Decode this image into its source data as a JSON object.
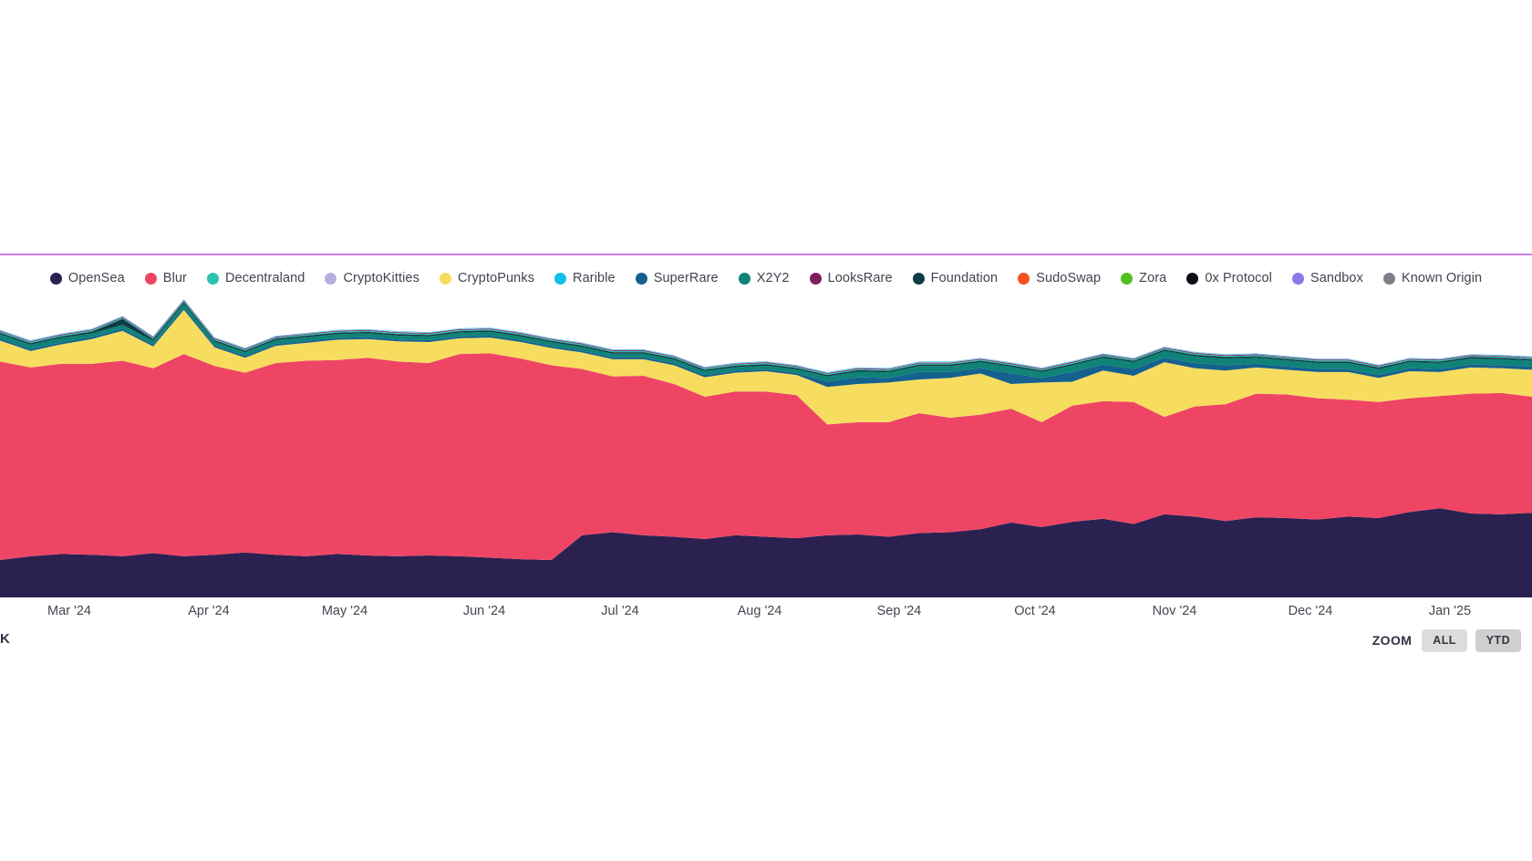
{
  "theme": {
    "divider_color": "#c77fe8",
    "background": "#ffffff",
    "text_color": "#43474f",
    "button_bg": "#dcdcdc"
  },
  "legend": {
    "items": [
      {
        "label": "OpenSea",
        "color": "#2b2151"
      },
      {
        "label": "Blur",
        "color": "#ef4565"
      },
      {
        "label": "Decentraland",
        "color": "#2cc3b0"
      },
      {
        "label": "CryptoKitties",
        "color": "#b6b0e0"
      },
      {
        "label": "CryptoPunks",
        "color": "#f6dd5f"
      },
      {
        "label": "Rarible",
        "color": "#12bfeb"
      },
      {
        "label": "SuperRare",
        "color": "#14618f"
      },
      {
        "label": "X2Y2",
        "color": "#0f8377"
      },
      {
        "label": "LooksRare",
        "color": "#7b1f5a"
      },
      {
        "label": "Foundation",
        "color": "#113b44"
      },
      {
        "label": "SudoSwap",
        "color": "#f4511e"
      },
      {
        "label": "Zora",
        "color": "#4fc020"
      },
      {
        "label": "0x Protocol",
        "color": "#0d0d17"
      },
      {
        "label": "Sandbox",
        "color": "#8878e8"
      },
      {
        "label": "Known Origin",
        "color": "#7c8088"
      }
    ]
  },
  "footer": {
    "y_axis_unit": "K",
    "zoom_label": "ZOOM",
    "zoom_buttons": [
      {
        "label": "ALL",
        "active": false
      },
      {
        "label": "YTD",
        "active": true
      }
    ]
  },
  "chart_data": {
    "type": "area",
    "stacked": true,
    "stack_mode": "absolute",
    "title": "",
    "xlabel": "",
    "ylabel": "K",
    "grid": false,
    "legend_position": "top-center",
    "axis_tick_labels": [
      "Mar '24",
      "Apr '24",
      "May '24",
      "Jun '24",
      "Jul '24",
      "Aug '24",
      "Sep '24",
      "Oct '24",
      "Nov '24",
      "Dec '24",
      "Jan '25"
    ],
    "x": [
      "2024-02-18",
      "2024-02-25",
      "2024-03-03",
      "2024-03-10",
      "2024-03-17",
      "2024-03-24",
      "2024-03-31",
      "2024-04-07",
      "2024-04-14",
      "2024-04-21",
      "2024-04-28",
      "2024-05-05",
      "2024-05-12",
      "2024-05-19",
      "2024-05-26",
      "2024-06-02",
      "2024-06-09",
      "2024-06-16",
      "2024-06-23",
      "2024-06-30",
      "2024-07-07",
      "2024-07-14",
      "2024-07-21",
      "2024-07-28",
      "2024-08-04",
      "2024-08-11",
      "2024-08-18",
      "2024-08-25",
      "2024-09-01",
      "2024-09-08",
      "2024-09-15",
      "2024-09-22",
      "2024-09-29",
      "2024-10-06",
      "2024-10-13",
      "2024-10-20",
      "2024-10-27",
      "2024-11-03",
      "2024-11-10",
      "2024-11-17",
      "2024-11-24",
      "2024-12-01",
      "2024-12-08",
      "2024-12-15",
      "2024-12-22",
      "2024-12-29",
      "2025-01-05",
      "2025-01-12",
      "2025-01-19",
      "2025-01-26",
      "2025-02-02"
    ],
    "series": [
      {
        "name": "OpenSea",
        "color": "#2b2151",
        "values": [
          10.0,
          11.0,
          11.6,
          11.4,
          11.0,
          11.8,
          11.0,
          11.4,
          12.0,
          11.4,
          11.0,
          11.6,
          11.2,
          11.0,
          11.2,
          11.0,
          10.6,
          10.2,
          10.0,
          16.6,
          17.4,
          16.6,
          16.2,
          15.6,
          16.6,
          16.2,
          15.8,
          16.6,
          16.8,
          16.2,
          17.2,
          17.4,
          18.2,
          20.0,
          18.8,
          20.2,
          21.0,
          19.6,
          22.2,
          21.6,
          20.4,
          21.4,
          21.2,
          20.8,
          21.6,
          21.2,
          22.8,
          23.8,
          22.4,
          22.2,
          22.6
        ]
      },
      {
        "name": "Blur",
        "color": "#ef4565",
        "values": [
          53.0,
          50.4,
          50.8,
          51.0,
          52.2,
          49.4,
          54.0,
          50.4,
          48.0,
          51.2,
          52.2,
          51.8,
          52.8,
          52.0,
          51.4,
          54.0,
          54.6,
          53.6,
          52.0,
          44.4,
          41.6,
          42.6,
          40.8,
          38.0,
          38.4,
          38.8,
          38.2,
          29.6,
          30.0,
          30.6,
          32.0,
          30.6,
          30.6,
          30.4,
          28.0,
          31.0,
          31.4,
          32.6,
          26.0,
          29.4,
          31.2,
          33.0,
          33.0,
          32.4,
          31.2,
          31.0,
          30.4,
          30.0,
          32.0,
          32.4,
          31.0
        ]
      },
      {
        "name": "CryptoPunks",
        "color": "#f6dd5f",
        "values": [
          5.6,
          4.4,
          5.2,
          6.6,
          8.0,
          5.8,
          11.8,
          5.0,
          4.0,
          4.6,
          4.8,
          5.4,
          5.0,
          5.4,
          5.6,
          4.2,
          4.2,
          4.4,
          4.6,
          4.4,
          4.6,
          4.4,
          5.0,
          5.2,
          5.0,
          5.4,
          5.4,
          10.0,
          10.2,
          10.6,
          9.0,
          10.6,
          11.0,
          6.6,
          10.6,
          6.4,
          8.2,
          7.0,
          14.6,
          10.2,
          9.0,
          7.0,
          6.6,
          7.0,
          7.4,
          6.4,
          7.2,
          6.4,
          7.0,
          6.6,
          7.2
        ]
      },
      {
        "name": "SuperRare",
        "color": "#14618f",
        "values": [
          0.5,
          0.5,
          0.5,
          0.5,
          0.6,
          0.5,
          0.6,
          0.5,
          0.5,
          0.5,
          0.5,
          0.5,
          0.5,
          0.5,
          0.5,
          0.5,
          0.5,
          0.5,
          0.5,
          0.5,
          0.5,
          0.5,
          0.5,
          0.6,
          0.5,
          0.5,
          0.5,
          1.4,
          1.8,
          1.2,
          2.0,
          1.6,
          1.4,
          2.8,
          1.2,
          2.6,
          1.6,
          1.8,
          1.2,
          1.4,
          1.4,
          1.0,
          0.9,
          0.8,
          0.8,
          0.8,
          0.8,
          0.8,
          0.8,
          0.8,
          0.8
        ]
      },
      {
        "name": "X2Y2",
        "color": "#0f8377",
        "values": [
          1.2,
          1.2,
          1.2,
          1.0,
          1.0,
          1.0,
          1.0,
          1.0,
          1.0,
          1.0,
          1.0,
          1.0,
          1.0,
          1.0,
          1.0,
          1.0,
          1.0,
          1.0,
          1.0,
          1.0,
          1.0,
          1.0,
          1.0,
          1.0,
          1.0,
          1.0,
          1.0,
          1.4,
          1.5,
          1.5,
          1.6,
          1.6,
          1.6,
          1.8,
          1.6,
          1.8,
          1.8,
          1.8,
          1.8,
          1.8,
          1.8,
          1.6,
          1.6,
          1.6,
          1.6,
          1.6,
          1.6,
          1.6,
          1.6,
          1.6,
          1.6
        ]
      },
      {
        "name": "Foundation",
        "color": "#113b44",
        "values": [
          0.4,
          0.4,
          0.4,
          0.5,
          1.6,
          0.5,
          0.5,
          0.4,
          0.4,
          0.4,
          0.4,
          0.4,
          0.4,
          0.4,
          0.4,
          0.4,
          0.4,
          0.4,
          0.4,
          0.4,
          0.4,
          0.4,
          0.4,
          0.4,
          0.4,
          0.4,
          0.4,
          0.4,
          0.4,
          0.4,
          0.4,
          0.4,
          0.4,
          0.4,
          0.4,
          0.4,
          0.4,
          0.4,
          0.4,
          0.4,
          0.4,
          0.4,
          0.4,
          0.4,
          0.4,
          0.4,
          0.4,
          0.4,
          0.4,
          0.4,
          0.4
        ]
      },
      {
        "name": "Decentraland",
        "color": "#2cc3b0",
        "values": [
          0.3,
          0.3,
          0.3,
          0.3,
          0.3,
          0.3,
          0.3,
          0.3,
          0.3,
          0.3,
          0.3,
          0.3,
          0.3,
          0.3,
          0.3,
          0.3,
          0.3,
          0.3,
          0.3,
          0.3,
          0.3,
          0.3,
          0.3,
          0.3,
          0.3,
          0.3,
          0.3,
          0.3,
          0.3,
          0.3,
          0.3,
          0.3,
          0.3,
          0.3,
          0.3,
          0.3,
          0.3,
          0.3,
          0.3,
          0.3,
          0.3,
          0.3,
          0.3,
          0.3,
          0.3,
          0.3,
          0.3,
          0.3,
          0.3,
          0.3,
          0.3
        ]
      },
      {
        "name": "LooksRare",
        "color": "#7b1f5a",
        "values": [
          0.2,
          0.2,
          0.2,
          0.2,
          0.2,
          0.2,
          0.2,
          0.2,
          0.2,
          0.2,
          0.2,
          0.2,
          0.2,
          0.2,
          0.2,
          0.2,
          0.2,
          0.2,
          0.2,
          0.2,
          0.2,
          0.2,
          0.2,
          0.2,
          0.2,
          0.2,
          0.2,
          0.2,
          0.2,
          0.2,
          0.2,
          0.2,
          0.2,
          0.2,
          0.2,
          0.2,
          0.2,
          0.2,
          0.2,
          0.2,
          0.2,
          0.2,
          0.2,
          0.2,
          0.2,
          0.2,
          0.2,
          0.2,
          0.2,
          0.2,
          0.2
        ]
      },
      {
        "name": "CryptoKitties",
        "color": "#b6b0e0",
        "values": [
          0.15,
          0.15,
          0.15,
          0.15,
          0.15,
          0.15,
          0.15,
          0.15,
          0.15,
          0.15,
          0.15,
          0.15,
          0.15,
          0.15,
          0.15,
          0.15,
          0.15,
          0.15,
          0.15,
          0.15,
          0.15,
          0.15,
          0.15,
          0.15,
          0.15,
          0.15,
          0.15,
          0.15,
          0.15,
          0.15,
          0.15,
          0.15,
          0.15,
          0.15,
          0.15,
          0.15,
          0.15,
          0.15,
          0.15,
          0.15,
          0.15,
          0.15,
          0.15,
          0.15,
          0.15,
          0.15,
          0.15,
          0.15,
          0.15,
          0.15,
          0.15
        ]
      },
      {
        "name": "Rarible",
        "color": "#12bfeb",
        "values": [
          0.1,
          0.1,
          0.1,
          0.1,
          0.1,
          0.1,
          0.1,
          0.1,
          0.1,
          0.1,
          0.1,
          0.1,
          0.1,
          0.1,
          0.1,
          0.1,
          0.1,
          0.1,
          0.1,
          0.1,
          0.1,
          0.1,
          0.1,
          0.1,
          0.1,
          0.1,
          0.1,
          0.1,
          0.1,
          0.1,
          0.1,
          0.1,
          0.1,
          0.1,
          0.1,
          0.1,
          0.1,
          0.1,
          0.1,
          0.1,
          0.1,
          0.1,
          0.1,
          0.1,
          0.1,
          0.1,
          0.1,
          0.1,
          0.1,
          0.1,
          0.1
        ]
      }
    ]
  }
}
